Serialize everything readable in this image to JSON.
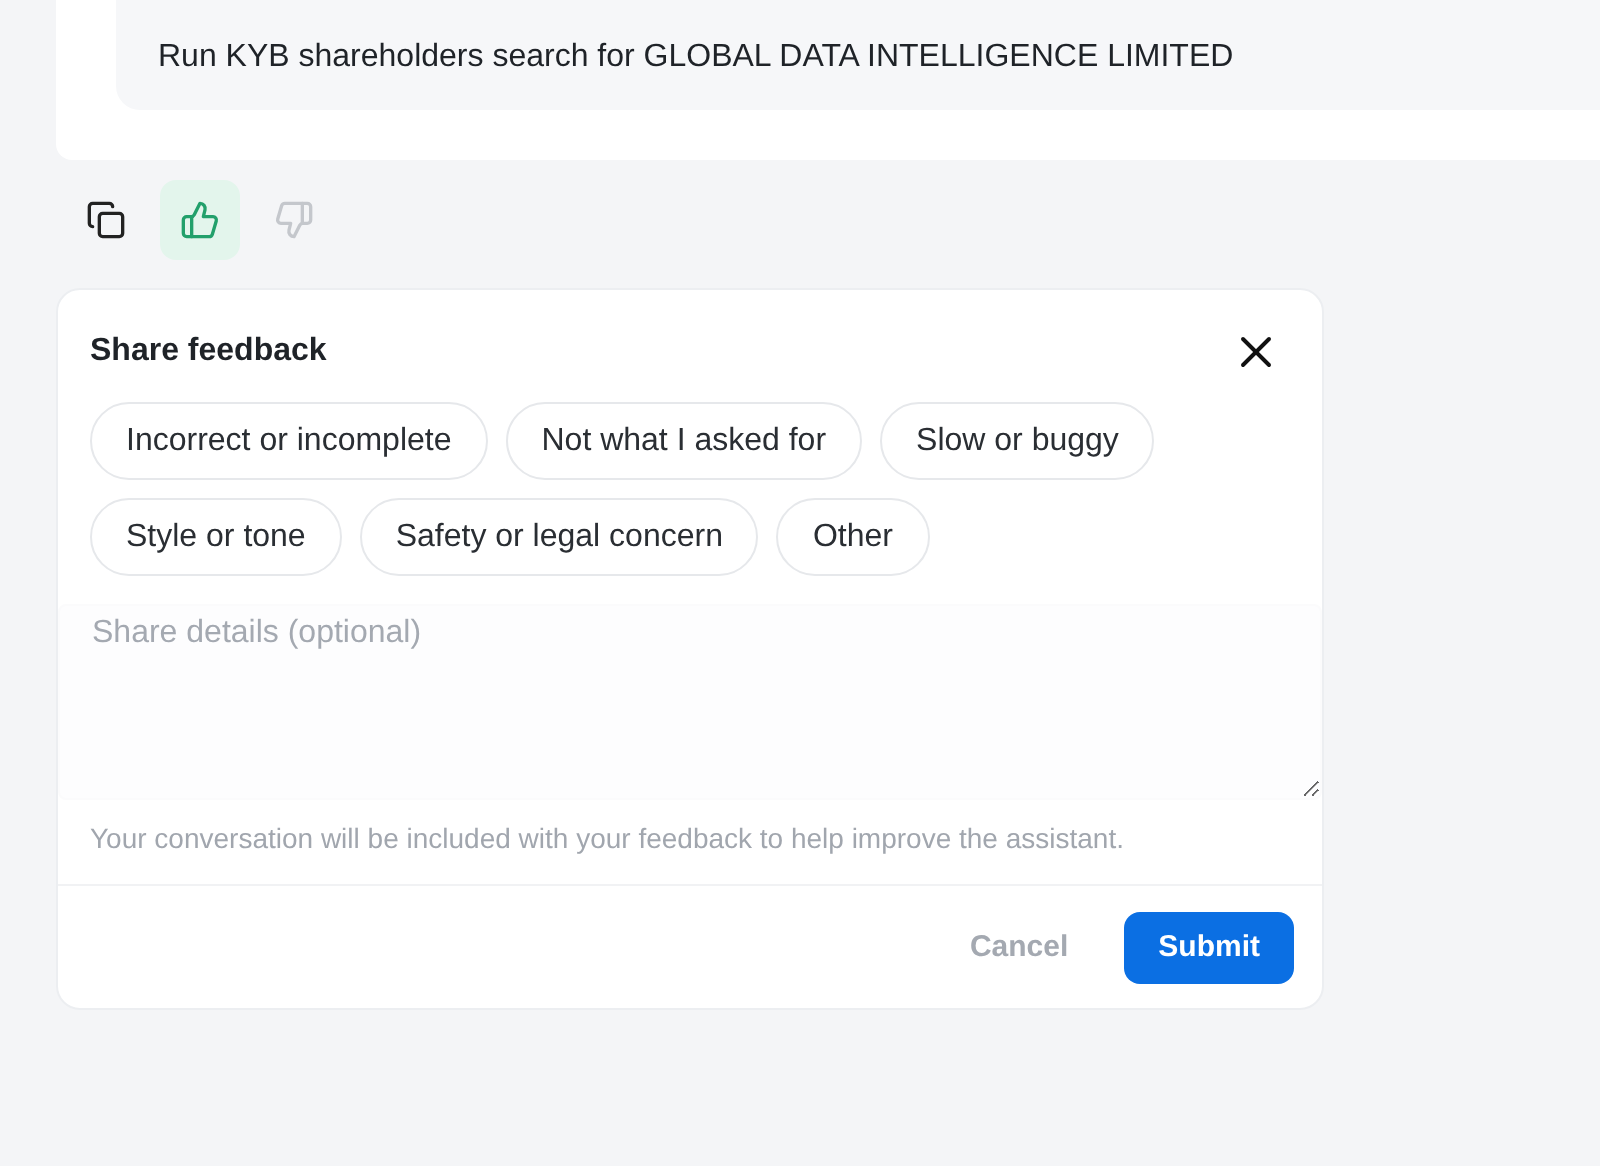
{
  "message": {
    "text": "Run KYB shareholders search for GLOBAL DATA INTELLIGENCE LIMITED"
  },
  "actions": [
    {
      "kind": "copy",
      "selected": false
    },
    {
      "kind": "like",
      "selected": true
    },
    {
      "kind": "dislike",
      "selected": false
    }
  ],
  "feedback": {
    "title": "Share feedback",
    "reasons": [
      {
        "label": "Incorrect or incomplete",
        "selected": false
      },
      {
        "label": "Not what I asked for",
        "selected": false
      },
      {
        "label": "Slow or buggy",
        "selected": false
      },
      {
        "label": "Style or tone",
        "selected": false
      },
      {
        "label": "Safety or legal concern",
        "selected": false
      },
      {
        "label": "Other",
        "selected": false
      }
    ],
    "details": {
      "placeholder": "Share details (optional)"
    },
    "note": "Your conversation will be included with your feedback to help improve the assistant.",
    "buttons": [
      {
        "kind": "secondary",
        "label": "Cancel"
      },
      {
        "kind": "primary",
        "label": "Submit"
      }
    ]
  }
}
